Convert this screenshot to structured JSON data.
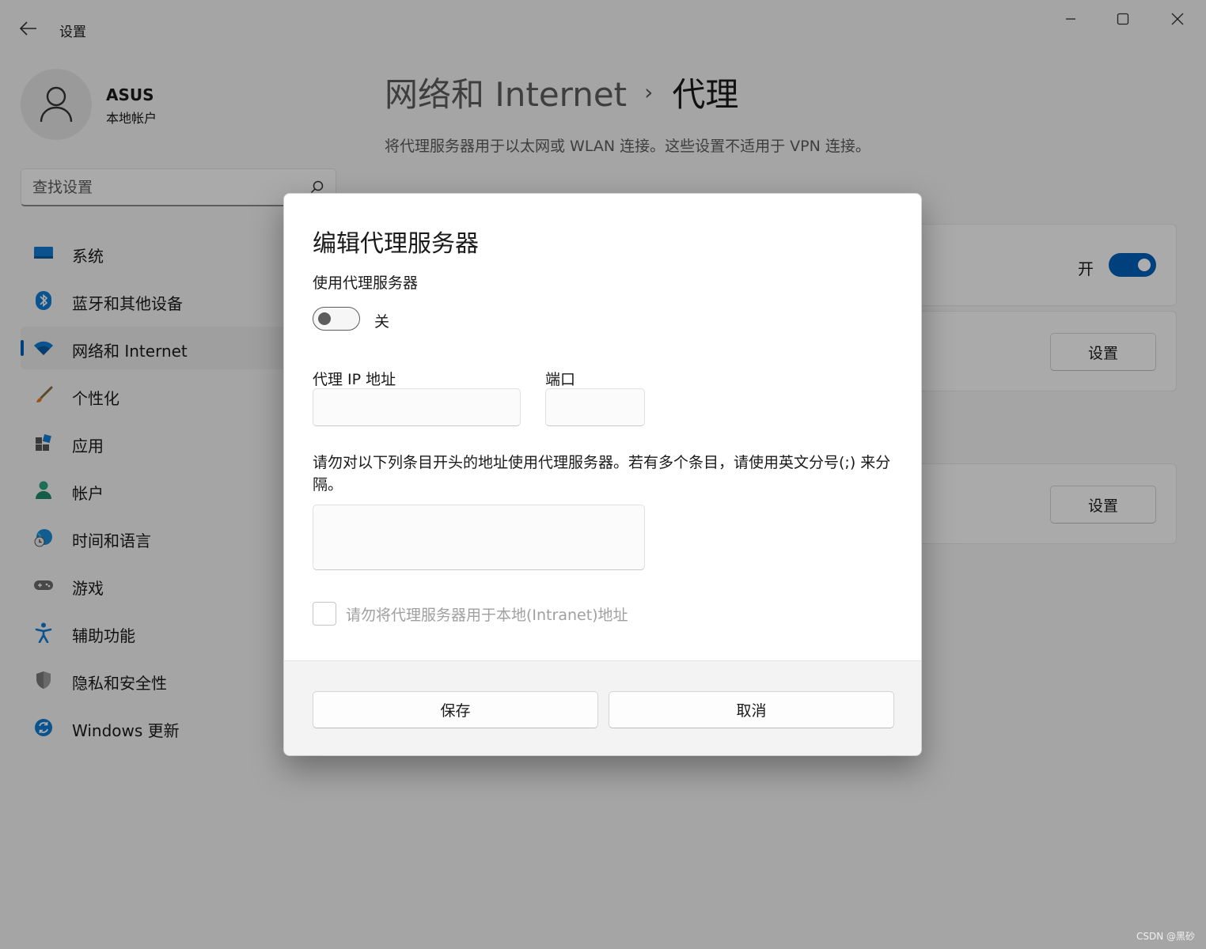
{
  "window": {
    "title": "设置",
    "controls": {
      "minimize": "minimize",
      "maximize": "maximize",
      "close": "close"
    }
  },
  "profile": {
    "name": "ASUS",
    "account_type": "本地帐户"
  },
  "search": {
    "placeholder": "查找设置"
  },
  "sidebar": {
    "items": [
      {
        "label": "系统",
        "icon": "display-icon"
      },
      {
        "label": "蓝牙和其他设备",
        "icon": "bluetooth-icon"
      },
      {
        "label": "网络和 Internet",
        "icon": "wifi-icon",
        "active": true
      },
      {
        "label": "个性化",
        "icon": "brush-icon"
      },
      {
        "label": "应用",
        "icon": "apps-icon"
      },
      {
        "label": "帐户",
        "icon": "person-icon"
      },
      {
        "label": "时间和语言",
        "icon": "globe-clock-icon"
      },
      {
        "label": "游戏",
        "icon": "gamepad-icon"
      },
      {
        "label": "辅助功能",
        "icon": "accessibility-icon"
      },
      {
        "label": "隐私和安全性",
        "icon": "shield-icon"
      },
      {
        "label": "Windows 更新",
        "icon": "update-icon"
      }
    ]
  },
  "header": {
    "breadcrumb_parent": "网络和 Internet",
    "breadcrumb_separator": "›",
    "breadcrumb_current": "代理",
    "description": "将代理服务器用于以太网或 WLAN 连接。这些设置不适用于 VPN 连接。"
  },
  "background_cards": {
    "auto_detect_toggle": {
      "state_label": "开",
      "on": true
    },
    "setup_script_button": "设置",
    "manual_setup_button": "设置"
  },
  "dialog": {
    "title": "编辑代理服务器",
    "use_proxy_label": "使用代理服务器",
    "use_proxy_state_label": "关",
    "use_proxy_on": false,
    "ip_label": "代理 IP 地址",
    "ip_value": "",
    "port_label": "端口",
    "port_value": "",
    "exceptions_label": "请勿对以下列条目开头的地址使用代理服务器。若有多个条目，请使用英文分号(;) 来分隔。",
    "exceptions_value": "",
    "local_bypass_label": "请勿将代理服务器用于本地(Intranet)地址",
    "local_bypass_checked": false,
    "save_label": "保存",
    "cancel_label": "取消"
  },
  "watermark": "CSDN @黑砂",
  "colors": {
    "accent": "#005fb8",
    "scrim": "rgba(0,0,0,0.32)"
  }
}
